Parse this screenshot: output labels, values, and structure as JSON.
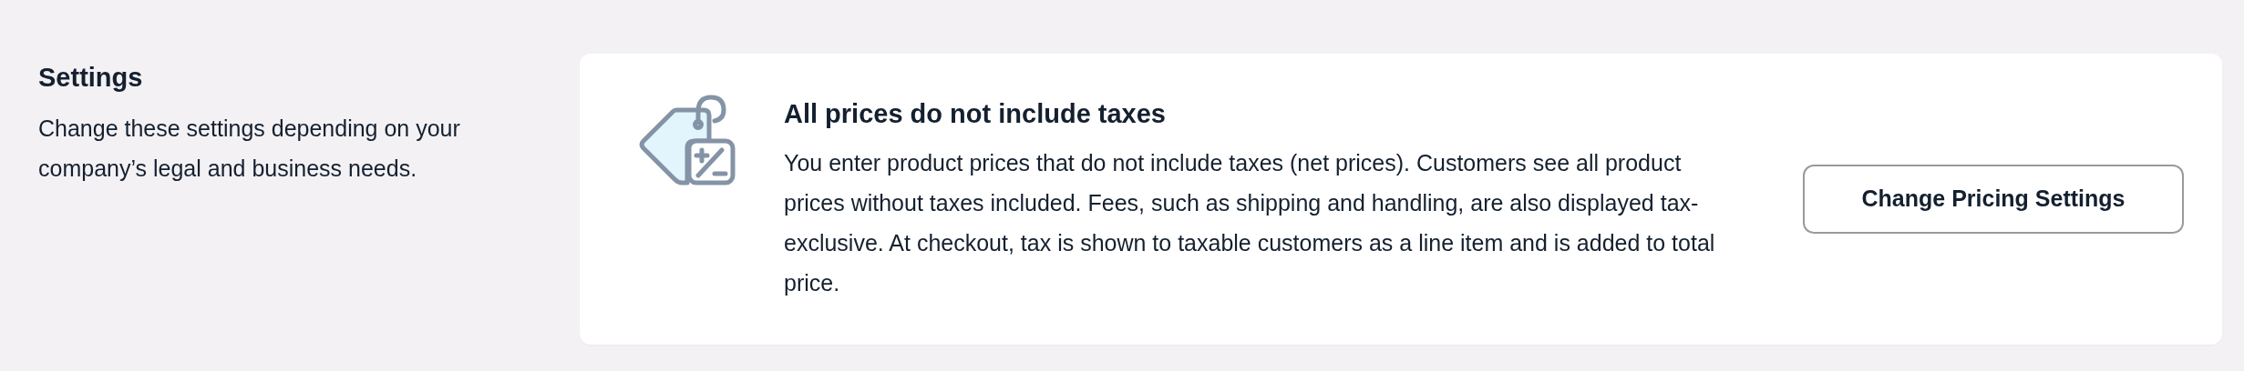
{
  "intro": {
    "title": "Settings",
    "description": "Change these settings depending on your company’s legal and business needs."
  },
  "pricing_card": {
    "title": "All prices do not include taxes",
    "description": "You enter product prices that do not include taxes (net prices). Customers see all product prices without taxes included. Fees, such as shipping and handling, are also displayed tax-exclusive. At checkout, tax is shown to taxable customers as a line item and is added to total price.",
    "button": "Change Pricing Settings"
  }
}
